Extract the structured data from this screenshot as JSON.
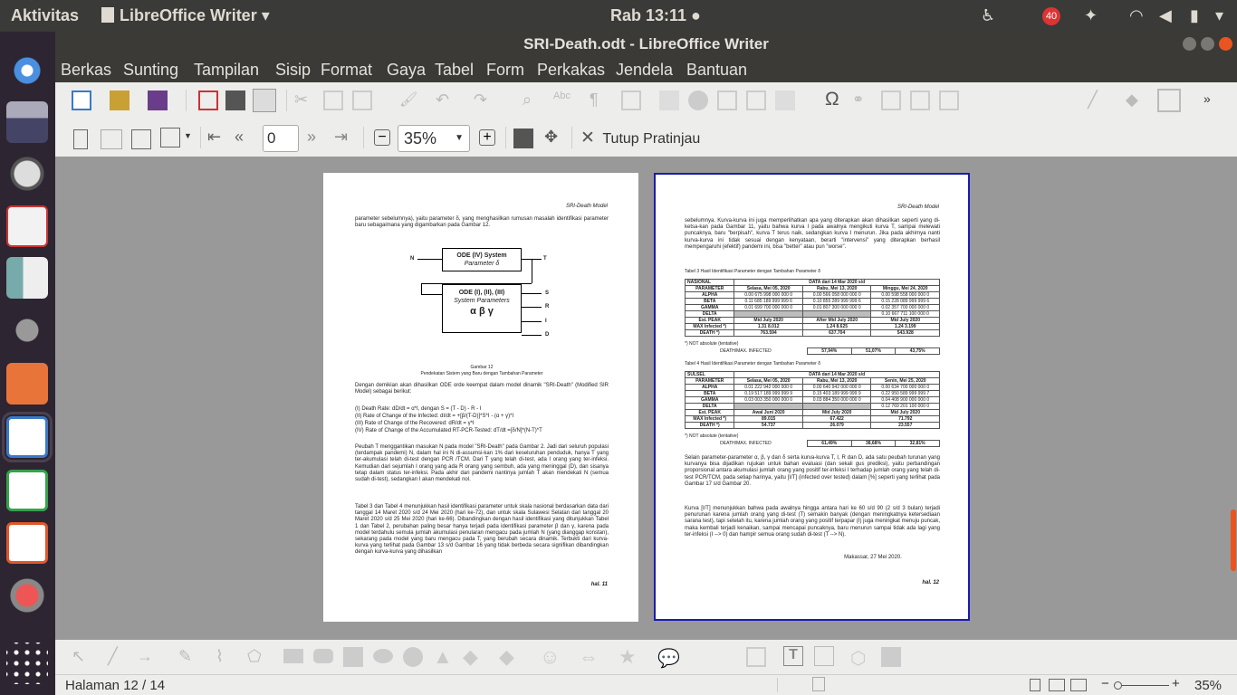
{
  "topbar": {
    "activities": "Aktivitas",
    "app_menu": "LibreOffice Writer",
    "clock": "Rab 13:11 ●",
    "notif_count": "40"
  },
  "window": {
    "title": "SRI-Death.odt - LibreOffice Writer"
  },
  "menu": [
    "Berkas",
    "Sunting",
    "Tampilan",
    "Sisip",
    "Format",
    "Gaya",
    "Tabel",
    "Form",
    "Perkakas",
    "Jendela",
    "Bantuan"
  ],
  "preview": {
    "page_input": "0",
    "zoom": "35%",
    "close_label": "Tutup Pratinjau"
  },
  "status": {
    "page": "Halaman 12 / 14",
    "zoom": "35%"
  },
  "page11": {
    "header": "SRI-Death Model",
    "p1": "parameter sebelumnya), yaitu parameter δ, yang menghasilkan rumusan masalah identifikasi parameter baru sebagaimana yang digambarkan pada Gambar 12.",
    "fig_n": "N",
    "fig_t": "T",
    "box1_l1": "ODE (IV) System",
    "box1_l2": "Parameter δ",
    "box2_l1": "ODE (I), (II), (III)",
    "box2_l2": "System Parameters",
    "box2_l3": "α β γ",
    "out_s": "S",
    "out_r": "R",
    "out_i": "I",
    "out_d": "D",
    "caption1": "Gambar 12",
    "caption2": "Pendekatan Sistem yang Baru dengan Tambahan Parameter",
    "p2": "Dengan demikian akan dihasilkan ODE orde keempat dalam model dinamik \"SRI-Death\" (Modified SIR Model) sebagai berikut:",
    "eq1": "(I) Death Rate: dD/dt = α*I, dengan S = (T - D) - R - I",
    "eq2": "(II) Rate of Change of the Infected: dI/dt = +[β/(T-D)]*S*I - (α + γ)*I",
    "eq3": "(III) Rate of Change of the Recovered: dR/dt = γ*I",
    "eq4": "(IV) Rate of Change of the Accumulated RT-PCR-Tested: dT/dt =[δ/N]*(N-T)*T",
    "p3": "Peubah T menggantikan masukan N pada model \"SRI-Death\" pada Gambar 2. Jadi dari seluruh populasi (terdampak pandemi) N, dalam hal ini N di-assumsi-kan 1% dari keseluruhan penduduk, hanya T yang ter-akumulasi telah di-test dengan PCR /TCM. Dari T yang telah di-test, ada I orang yang ter-infeksi. Kemudian dari sejumlah I orang yang ada R orang yang sembuh, ada yang meninggal (D), dan sisanya tetap dalam status ter-infeksi. Pada akhir dari pandemi nantinya jumlah T akan mendekati N (semua sudah di-test), sedangkan I akan mendekati nol.",
    "p4": "Tabel 3 dan Tabel 4 menunjukkan hasil identifikasi parameter untuk skala nasional berdasarkan data dari tanggal 14 Maret 2020 s/d 24 Mei 2020 (hari ke-72), dan untuk skala Sulawesi Selatan dari tanggal 20 Maret 2020 s/d 25 Mei 2020 (hari ke-66). Dibandingkan dengan hasil identifikasi yang ditunjukkan Tabel 1 dan Tabel 2, perubahan paling besar hanya terjadi pada identifikasi parameter β dan γ, karena pada model terdahulu semula jumlah akumulasi penularan mengacu pada jumlah N (yang dianggap konstan), sekarang pada model yang baru mengacu pada T, yang berubah secara dinamik. Terbukti dari kurva-kurva yang terlihat pada Gambar 13 s/d Gambar 16 yang tidak berbeda secara signifikan dibandingkan dengan kurva-kurva yang dihasilkan",
    "footer": "hal. 11"
  },
  "page12": {
    "header": "SRI-Death Model",
    "p1": "sebelumnya. Kurva-kurva ini juga memperlihatkan apa yang diterapkan akan dihasilkan seperti yang di-ketsa-kan pada Gambar 11, yaitu bahwa kurva I pada awalnya mengikuti kurva T, sampai melewati puncaknya, baru \"berpisah\", kurva T terus naik, sedangkan kurva I menurun. Jika pada akhirnya nanti kurva-kurva ini tidak sesuai dengan kenyataan, berarti \"intervensi\" yang diterapkan berhasil mempengaruhi (efektif) pandemi ini, bisa \"better\" atau pun \"worse\".",
    "t3_caption": "Tabel 3 Hasil Identifikasi Parameter dengan Tambahan Parameter δ",
    "t3": [
      [
        "NASIONAL",
        "DATA dari 14 Mar 2020 s/d",
        "",
        ""
      ],
      [
        "PARAMETER",
        "Selasa, Mei 05, 2020",
        "Rabu, Mei 13, 2020",
        "Minggu, Mei 24, 2020"
      ],
      [
        "ALPHA",
        "0.00 675 998 000 000 0",
        "0.00 566 058 000 000 0",
        "0.00 598 558 000 000 0"
      ],
      [
        "BETA",
        "0.11 685 189 999 999 6",
        "0.10 855 289 999 999 6",
        "0.15 228 089 999 999 6"
      ],
      [
        "GAMMA",
        "0.01 699 700 000 000 0",
        "0.01 807 300 000 000 0",
        "0.02 357 700 000 000 0"
      ],
      [
        "DELTA",
        "",
        "",
        "0.10 667 711 100 000 0"
      ],
      [
        "Est. PEAK",
        "Mid July 2020",
        "After Mid July 2020",
        "Mid July 2020"
      ],
      [
        "MAX Infected *)",
        "1.31 8.012",
        "1.24 8.625",
        "1.24 3.199"
      ],
      [
        "DEATH *)",
        "763.594",
        "637.704",
        "543.928"
      ]
    ],
    "t3_note": "*) NOT absolute (tentative)",
    "t3_ratio": [
      "DEATH/MAX. INFECTED",
      "57,94%",
      "51,07%",
      "43,75%"
    ],
    "t4_caption": "Tabel 4 Hasil Identifikasi Parameter dengan Tambahan Parameter δ",
    "t4": [
      [
        "SULSEL",
        "DATA dari 14 Mar 2020 s/d",
        "",
        ""
      ],
      [
        "PARAMETER",
        "Selasa, Mei 05, 2020",
        "Rabu, Mei 13, 2020",
        "Senin, Mei 25, 2020"
      ],
      [
        "ALPHA",
        "0.01 222 942 000 000 0",
        "0.00 640 942 000 000 0",
        "0.00 634 700 000 000 0"
      ],
      [
        "BETA",
        "0.19 517 189 999 999 9",
        "0.15 403 189 999 999 9",
        "0.22 950 589 999 999 7"
      ],
      [
        "GAMMA",
        "0.03 003 350 000 000 0",
        "0.03 884 350 000 000 0",
        "0.04 408 900 000 000 0"
      ],
      [
        "DELTA",
        "",
        "",
        "0.12 769 201 100 000 0"
      ],
      [
        "Est. PEAK",
        "Awal Juni 2020",
        "Mid July 2020",
        "Mid July 2020"
      ],
      [
        "MAX Infected *)",
        "89.015",
        "67.422",
        "71.792"
      ],
      [
        "DEATH *)",
        "54.737",
        "26.079",
        "23.557"
      ]
    ],
    "t4_note": "*) NOT absolute (tentative)",
    "t4_ratio": [
      "DEATH/MAX. INFECTED",
      "61,49%",
      "38,68%",
      "32,81%"
    ],
    "p2": "Selain parameter-parameter α, β, γ dan δ serta kurva-kurva T, I, R dan D, ada satu peubah turunan yang kurvanya bisa dijadikan rujukan untuk bahan evaluasi (dan sekali gus prediksi), yaitu perbandingan proporsional antara akumulasi jumlah orang yang positif ter-infeksi I terhadap jumlah orang yang telah di-test PCR/TCM, pada setiap harinya, yaitu [I/T] (infected over tested) dalam [%] seperti yang terlihat pada Gambar 17 s/d Gambar 20.",
    "p3": "Kurva [I/T] menunjukkan bahwa pada awalnya hingga antara hari ke 60 s/d 90 (2 s/d 3 bulan) terjadi penurunan karena jumlah orang yang di-test (T) semakin banyak (dengan meningkatnya ketersediaan sarana test), tapi setelah itu, karena jumlah orang yang positif terpapar (I) juga meningkat menuju puncak, maka kembali terjadi kenaikan, sampai mencapai puncaknya, baru menurun sampai tidak ada lagi yang ter-infeksi (I --> 0) dan hampir semua orang sudah di-test (T --> N).",
    "sign": "Makassar, 27 Mei 2020.",
    "footer": "hal. 12"
  }
}
